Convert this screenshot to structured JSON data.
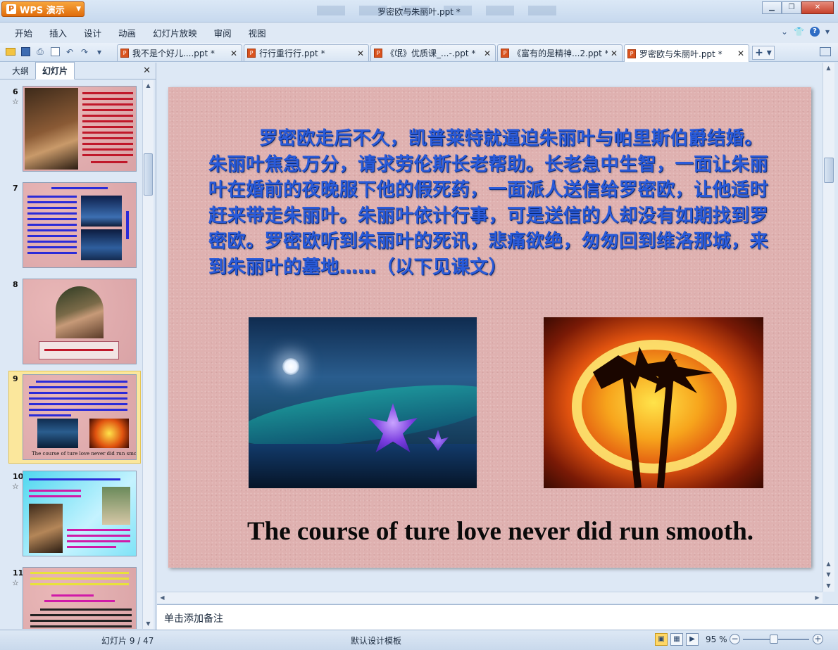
{
  "app": {
    "button_label": "WPS 演示",
    "window_title": "罗密欧与朱丽叶.ppt *"
  },
  "menu": [
    "开始",
    "插入",
    "设计",
    "动画",
    "幻灯片放映",
    "审阅",
    "视图"
  ],
  "tabs": [
    {
      "label": "我不是个好儿....ppt *"
    },
    {
      "label": "行行重行行.ppt *"
    },
    {
      "label": "《氓》优质课_...-.ppt *"
    },
    {
      "label": "《富有的是精神...2.ppt *"
    },
    {
      "label": "罗密欧与朱丽叶.ppt *",
      "active": true
    }
  ],
  "left_panel": {
    "tab_outline": "大纲",
    "tab_slides": "幻灯片",
    "thumbnails": [
      {
        "number": "6",
        "star": "☆"
      },
      {
        "number": "7",
        "star": ""
      },
      {
        "number": "8",
        "star": ""
      },
      {
        "number": "9",
        "star": "",
        "selected": true
      },
      {
        "number": "10",
        "star": "☆"
      },
      {
        "number": "11",
        "star": "☆"
      }
    ]
  },
  "slide": {
    "body_text": "罗密欧走后不久，凯普莱特就逼迫朱丽叶与帕里斯伯爵结婚。朱丽叶焦急万分，请求劳伦斯长老帮助。长老急中生智，一面让朱丽叶在婚前的夜晚服下他的假死药，一面派人送信给罗密欧，让他适时赶来带走朱丽叶。朱丽叶依计行事，可是送信的人却没有如期找到罗密欧。罗密欧听到朱丽叶的死讯，悲痛欲绝，匆匆回到维洛那城，来到朱丽叶的墓地……（以下见课文）",
    "caption": "The course of  ture love never did run smooth."
  },
  "notes": {
    "placeholder": "单击添加备注"
  },
  "status": {
    "slide_count": "幻灯片 9 / 47",
    "template": "默认设计模板",
    "zoom": "95 %"
  }
}
